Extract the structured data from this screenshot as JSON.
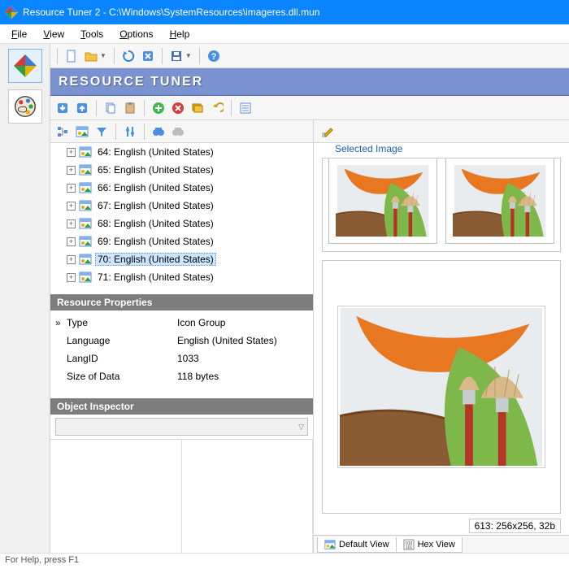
{
  "titlebar": {
    "title": "Resource Tuner 2 - C:\\Windows\\SystemResources\\imageres.dll.mun"
  },
  "menu": {
    "file": "File",
    "view": "View",
    "tools": "Tools",
    "options": "Options",
    "help": "Help"
  },
  "banner": "RESOURCE TUNER",
  "tree": {
    "items": [
      {
        "label": "64: English (United States)"
      },
      {
        "label": "65: English (United States)"
      },
      {
        "label": "66: English (United States)"
      },
      {
        "label": "67: English (United States)"
      },
      {
        "label": "68: English (United States)"
      },
      {
        "label": "69: English (United States)"
      },
      {
        "label": "70: English (United States)",
        "selected": true
      },
      {
        "label": "71: English (United States)"
      }
    ]
  },
  "props": {
    "header": "Resource Properties",
    "rows": [
      {
        "key": "Type",
        "val": "Icon Group",
        "marker": "»"
      },
      {
        "key": "Language",
        "val": "English (United States)"
      },
      {
        "key": "LangID",
        "val": "1033"
      },
      {
        "key": "Size of Data",
        "val": "118 bytes"
      }
    ]
  },
  "inspector": {
    "header": "Object Inspector"
  },
  "right": {
    "selected_image_label": "Selected Image",
    "status": "613: 256x256, 32b",
    "tabs": {
      "default": "Default View",
      "hex": "Hex View"
    }
  },
  "footer": "For Help, press F1"
}
